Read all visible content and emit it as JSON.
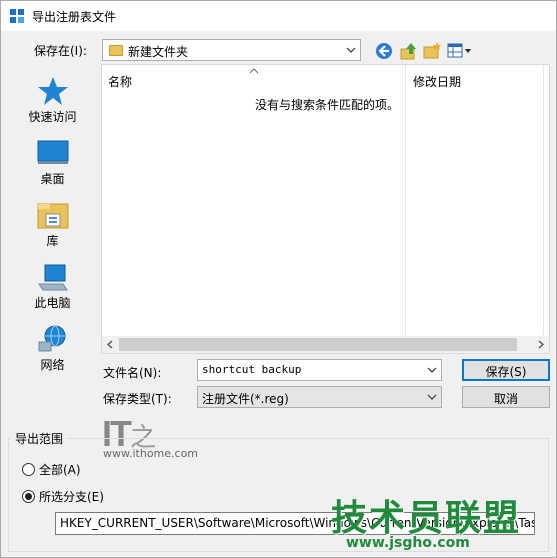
{
  "window": {
    "title": "导出注册表文件"
  },
  "save_in": {
    "label": "保存在(I):",
    "value": "新建文件夹"
  },
  "toolbar": {
    "icons": [
      "back-icon",
      "up-folder-icon",
      "new-folder-icon",
      "view-menu-icon"
    ]
  },
  "places": [
    {
      "label": "快速访问",
      "icon": "star-icon"
    },
    {
      "label": "桌面",
      "icon": "desktop-icon"
    },
    {
      "label": "库",
      "icon": "library-icon"
    },
    {
      "label": "此电脑",
      "icon": "computer-icon"
    },
    {
      "label": "网络",
      "icon": "network-icon"
    }
  ],
  "filelist": {
    "columns": [
      "名称",
      "修改日期"
    ],
    "empty_message": "没有与搜索条件匹配的项。"
  },
  "filename": {
    "label": "文件名(N):",
    "value": "shortcut backup"
  },
  "filetype": {
    "label": "保存类型(T):",
    "value": "注册文件(*.reg)"
  },
  "buttons": {
    "save": "保存(S)",
    "cancel": "取消"
  },
  "export_range": {
    "title": "导出范围",
    "all_label": "全部(A)",
    "selected_label": "所选分支(E)",
    "selected": "selected",
    "key_path": "HKEY_CURRENT_USER\\Software\\Microsoft\\Windows\\CurrentVersion\\Explorer\\Tas"
  },
  "watermarks": {
    "ithome_logo": "IT之家",
    "ithome_url": "www.ithome.com",
    "jsgho_logo": "技术员联盟",
    "jsgho_url": "www.jsgho.com"
  },
  "colors": {
    "accent": "#0078d7",
    "watermark_green": "#1e8c3a"
  }
}
